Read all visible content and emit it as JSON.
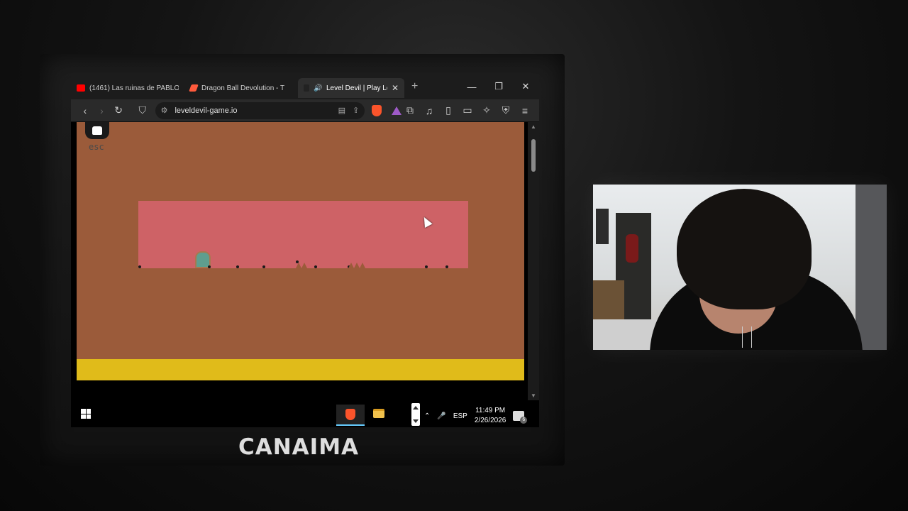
{
  "browser": {
    "tabs": [
      {
        "title": "(1461) Las ruinas de PABLO",
        "icon": "youtube-icon",
        "color": "#ff0000"
      },
      {
        "title": "Dragon Ball Devolution - T",
        "icon": "edit-icon",
        "color": "#ff5a3c"
      },
      {
        "title": "Level Devil | Play Le",
        "icon": "game-icon",
        "color": "#dddddd",
        "active": true
      }
    ],
    "new_tab": "+",
    "window_controls": {
      "minimize": "—",
      "maximize": "❐",
      "close": "✕"
    },
    "url": "leveldevil-game.io"
  },
  "game": {
    "esc_label": "esc",
    "background_color": "#9b5b3a",
    "room_color": "#ce6266",
    "floor_color": "#e0bb1a",
    "door_color": "#5e9e8e"
  },
  "taskbar": {
    "language": "ESP",
    "time": "11:49 PM",
    "date": "2/26/2026",
    "notifications": "6"
  },
  "overlay": {
    "brand": "CANAIMA"
  }
}
